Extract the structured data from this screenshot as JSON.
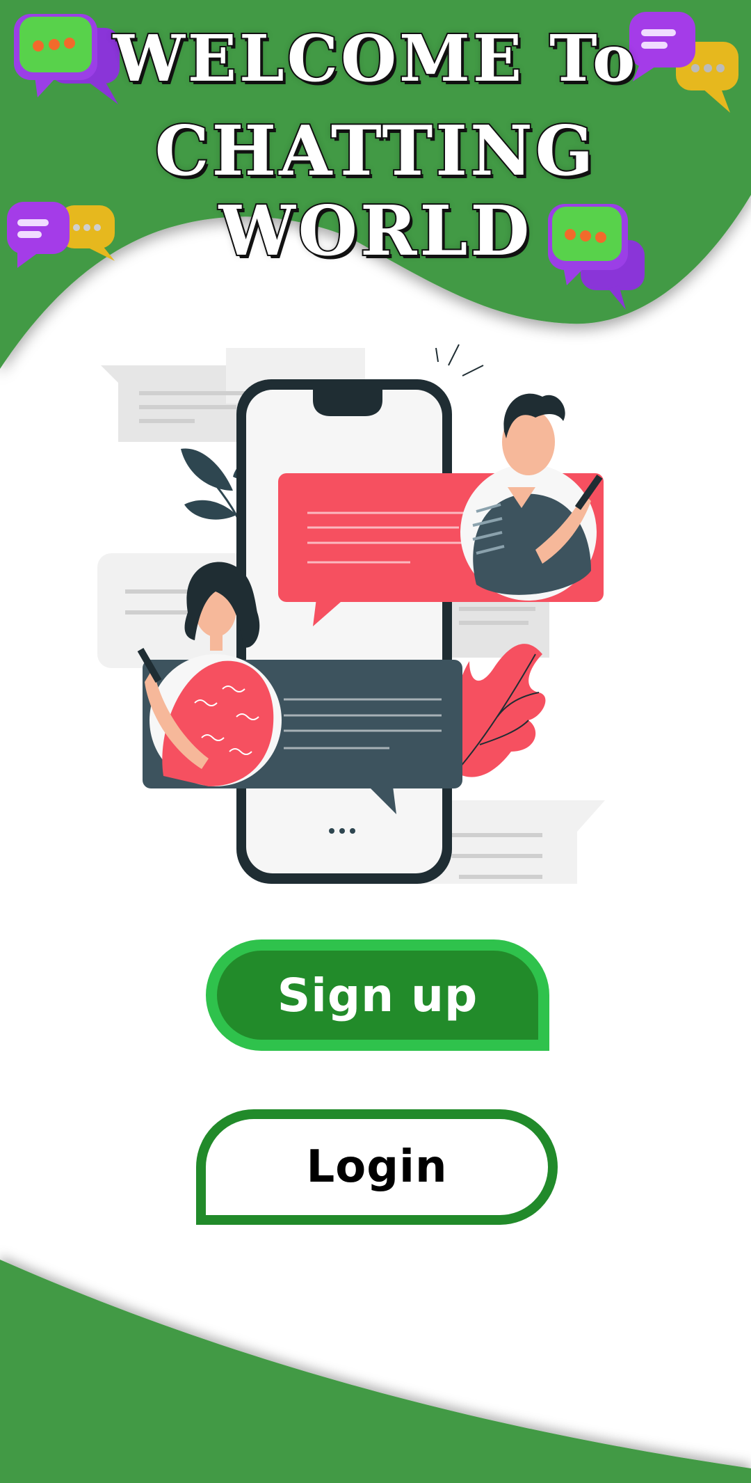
{
  "header": {
    "title_line1": "WELCOME To",
    "title_line2": "CHATTING WORLD"
  },
  "buttons": {
    "signup_label": "Sign up",
    "login_label": "Login"
  },
  "illustration": {
    "typing_dots": "•••"
  },
  "colors": {
    "brand_green": "#439a44",
    "signup_fill": "#228b2a",
    "signup_border": "#2fc24c",
    "login_border": "#218a2a",
    "chat_red": "#f65060",
    "chat_dark": "#3d535e"
  },
  "icons": [
    "chat-bubble-green-icon",
    "chat-bubble-purple-icon",
    "chat-bubble-yellow-icon"
  ]
}
